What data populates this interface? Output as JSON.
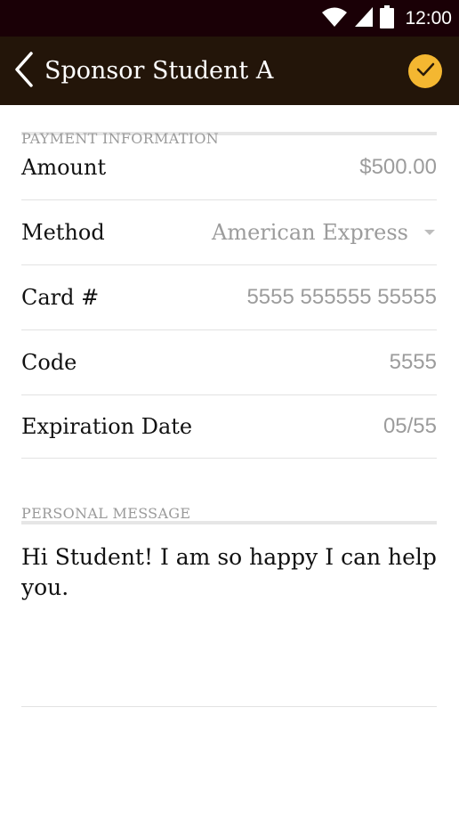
{
  "status_bar": {
    "time": "12:00",
    "icons": [
      "wifi-icon",
      "signal-icon",
      "battery-icon"
    ],
    "background": "#1a0006"
  },
  "app_bar": {
    "title": "Sponsor Student A",
    "back_icon": "chevron-left-icon",
    "confirm_icon": "check-icon",
    "background": "#231509",
    "accent": "#f4b731"
  },
  "payment": {
    "header": "PAYMENT INFORMATION",
    "amount_label": "Amount",
    "amount_value": "$500.00",
    "method_label": "Method",
    "method_value": "American Express",
    "card_label": "Card #",
    "card_value": "5555 555555 55555",
    "code_label": "Code",
    "code_value": "5555",
    "expiration_label": "Expiration Date",
    "expiration_value": "05/55"
  },
  "message": {
    "header": "PERSONAL MESSAGE",
    "text": "Hi Student! I am so happy I can help you."
  }
}
